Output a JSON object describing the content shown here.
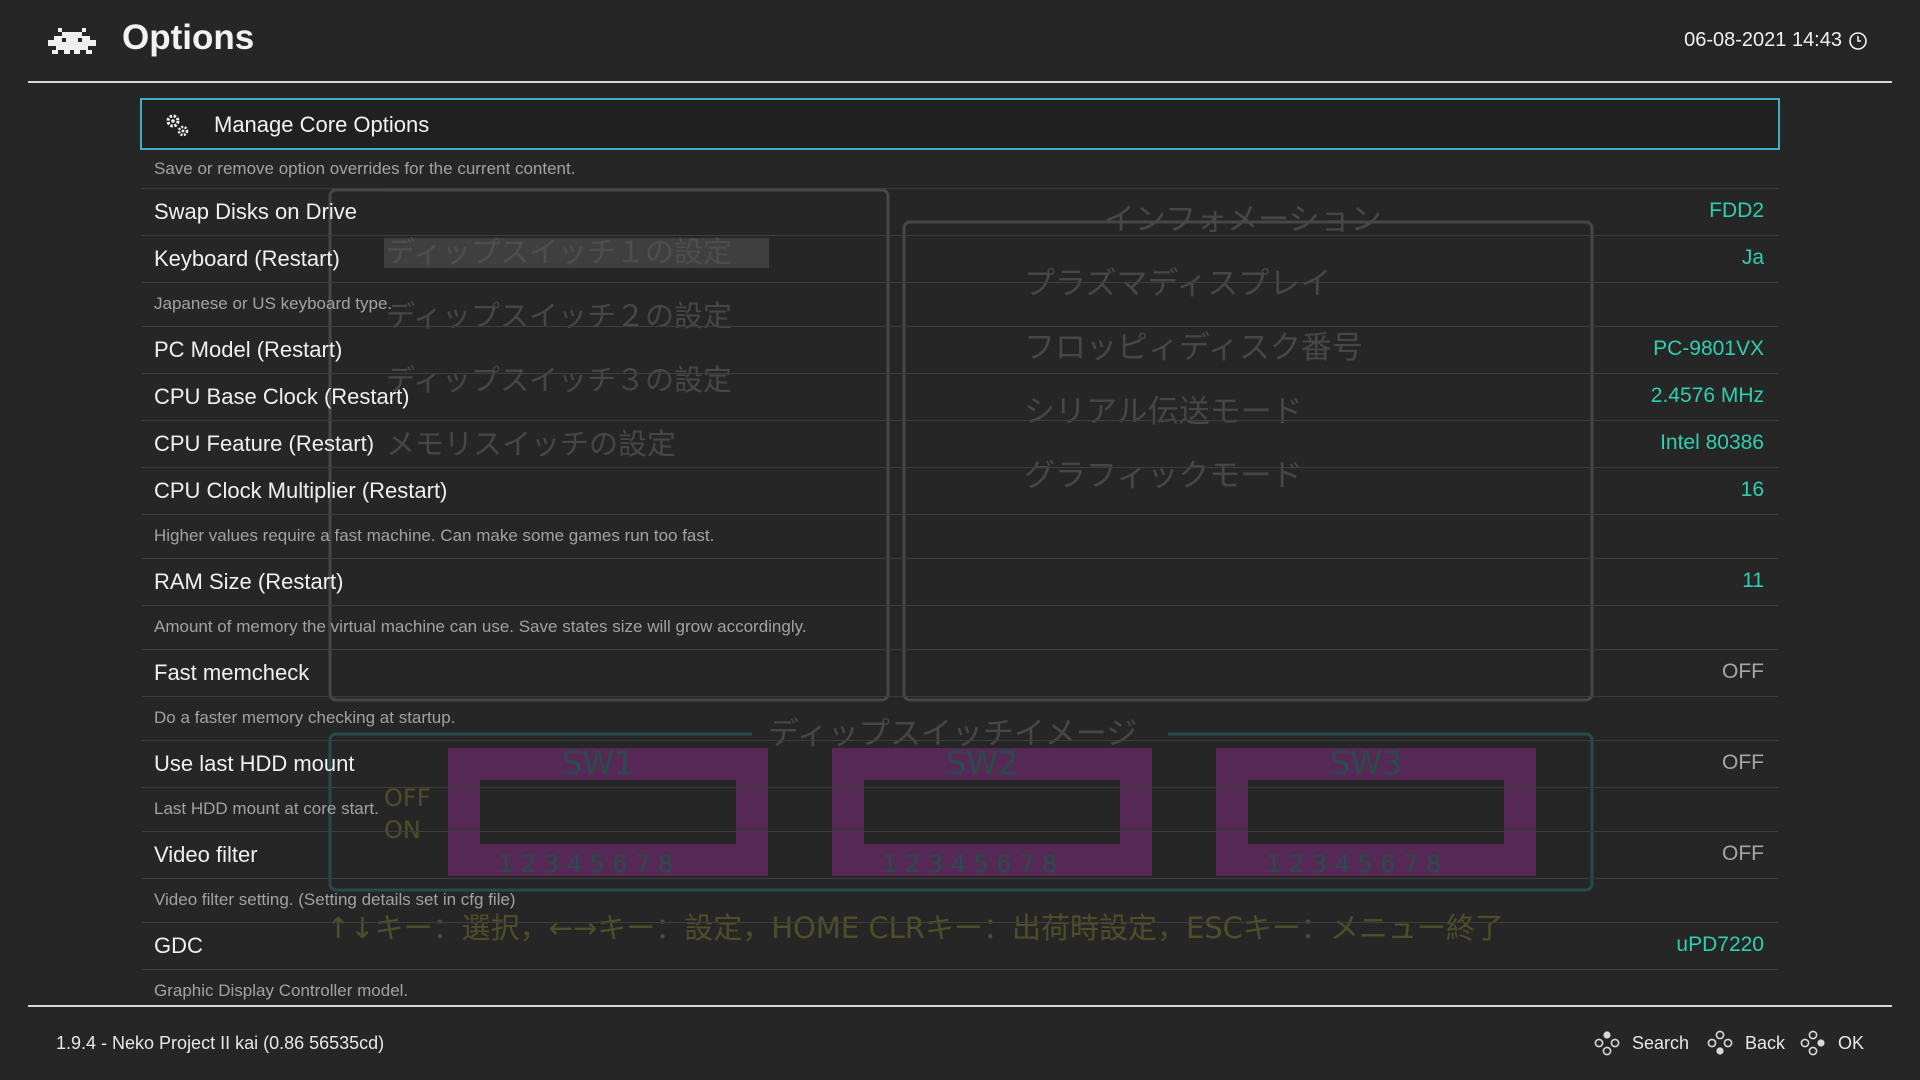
{
  "header": {
    "title": "Options",
    "datetime": "06-08-2021 14:43"
  },
  "menu": {
    "selected_label": "Manage Core Options",
    "selected_description": "Save or remove option overrides for the current content.",
    "items": [
      {
        "label": "Swap Disks on Drive",
        "value": "FDD2",
        "value_state": "on"
      },
      {
        "label": "Keyboard (Restart)",
        "value": "Ja",
        "value_state": "on",
        "description": "Japanese or US keyboard type."
      },
      {
        "label": "PC Model (Restart)",
        "value": "PC-9801VX",
        "value_state": "on"
      },
      {
        "label": "CPU Base Clock (Restart)",
        "value": "2.4576 MHz",
        "value_state": "on"
      },
      {
        "label": "CPU Feature (Restart)",
        "value": "Intel 80386",
        "value_state": "on"
      },
      {
        "label": "CPU Clock Multiplier (Restart)",
        "value": "16",
        "value_state": "on",
        "description": "Higher values require a fast machine. Can make some games run too fast."
      },
      {
        "label": "RAM Size (Restart)",
        "value": "11",
        "value_state": "on",
        "description": "Amount of memory the virtual machine can use. Save states size will grow accordingly."
      },
      {
        "label": "Fast memcheck",
        "value": "OFF",
        "value_state": "off",
        "description": "Do a faster memory checking at startup."
      },
      {
        "label": "Use last HDD mount",
        "value": "OFF",
        "value_state": "off",
        "description": "Last HDD mount at core start."
      },
      {
        "label": "Video filter",
        "value": "OFF",
        "value_state": "off",
        "description": "Video filter setting. (Setting details set in cfg file)"
      },
      {
        "label": "GDC",
        "value": "uPD7220",
        "value_state": "on",
        "description": "Graphic Display Controller model."
      }
    ]
  },
  "background_screen": {
    "menu_lines": [
      "ディップスイッチ１の設定",
      "ディップスイッチ２の設定",
      "ディップスイッチ３の設定",
      "メモリスイッチの設定"
    ],
    "info_title": "インフォメーション",
    "info_lines": [
      "プラズマディスプレイ",
      "フロッピィディスク番号",
      "シリアル伝送モード",
      "グラフィックモード"
    ],
    "dip_title": "ディップスイッチイメージ",
    "switches": [
      "SW1",
      "SW2",
      "SW3"
    ],
    "switch_numbers": "1 2 3 4 5 6 7 8",
    "off_label": "OFF",
    "on_label": "ON",
    "help_line": "↑↓キー：選択，←→キー：設定，HOME CLRキー：出荷時設定，ESCキー：メニュー終了"
  },
  "footer": {
    "version": "1.9.4 - Neko Project II kai (0.86  56535cd)",
    "hints": [
      "Search",
      "Back",
      "OK"
    ]
  },
  "colors": {
    "accent": "#46a9c9",
    "value_on": "#2ed0b0",
    "value_off": "#a6a6a6",
    "background": "#262626"
  }
}
